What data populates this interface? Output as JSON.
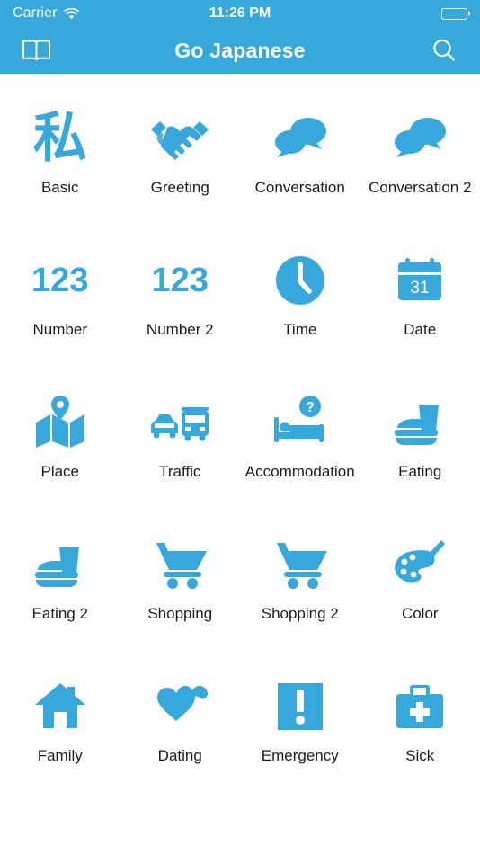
{
  "status_bar": {
    "carrier": "Carrier",
    "wifi_icon": "wifi-icon",
    "time": "11:26 PM",
    "battery_icon": "battery-full-icon"
  },
  "nav_bar": {
    "title": "Go Japanese",
    "left_button": {
      "name": "book-icon",
      "label": "Book"
    },
    "right_button": {
      "name": "search-icon",
      "label": "Search"
    }
  },
  "colors": {
    "accent": "#37A8DC",
    "nav_background": "#37A8DC",
    "page_background": "#ffffff",
    "label_text": "#1b1b1b",
    "status_text": "#ffffff"
  },
  "grid": {
    "columns": 4,
    "rows": 5,
    "items": [
      {
        "label": "Basic",
        "icon": "kanji-watashi-icon",
        "glyph": "私"
      },
      {
        "label": "Greeting",
        "icon": "handshake-icon"
      },
      {
        "label": "Conversation",
        "icon": "speech-bubbles-icon"
      },
      {
        "label": "Conversation 2",
        "icon": "speech-bubbles-icon"
      },
      {
        "label": "Number",
        "icon": "numbers-123-icon",
        "glyph": "123"
      },
      {
        "label": "Number 2",
        "icon": "numbers-123-icon",
        "glyph": "123"
      },
      {
        "label": "Time",
        "icon": "clock-icon"
      },
      {
        "label": "Date",
        "icon": "calendar-icon",
        "glyph": "31"
      },
      {
        "label": "Place",
        "icon": "map-pin-icon"
      },
      {
        "label": "Traffic",
        "icon": "taxi-bus-icon"
      },
      {
        "label": "Accommodation",
        "icon": "bed-question-icon",
        "glyph": "?"
      },
      {
        "label": "Eating",
        "icon": "burger-drink-icon"
      },
      {
        "label": "Eating 2",
        "icon": "burger-drink-icon"
      },
      {
        "label": "Shopping",
        "icon": "shopping-cart-icon"
      },
      {
        "label": "Shopping 2",
        "icon": "shopping-cart-icon"
      },
      {
        "label": "Color",
        "icon": "palette-brush-icon"
      },
      {
        "label": "Family",
        "icon": "house-icon"
      },
      {
        "label": "Dating",
        "icon": "hearts-icon"
      },
      {
        "label": "Emergency",
        "icon": "exclamation-square-icon",
        "glyph": "!"
      },
      {
        "label": "Sick",
        "icon": "medical-kit-icon"
      }
    ]
  }
}
